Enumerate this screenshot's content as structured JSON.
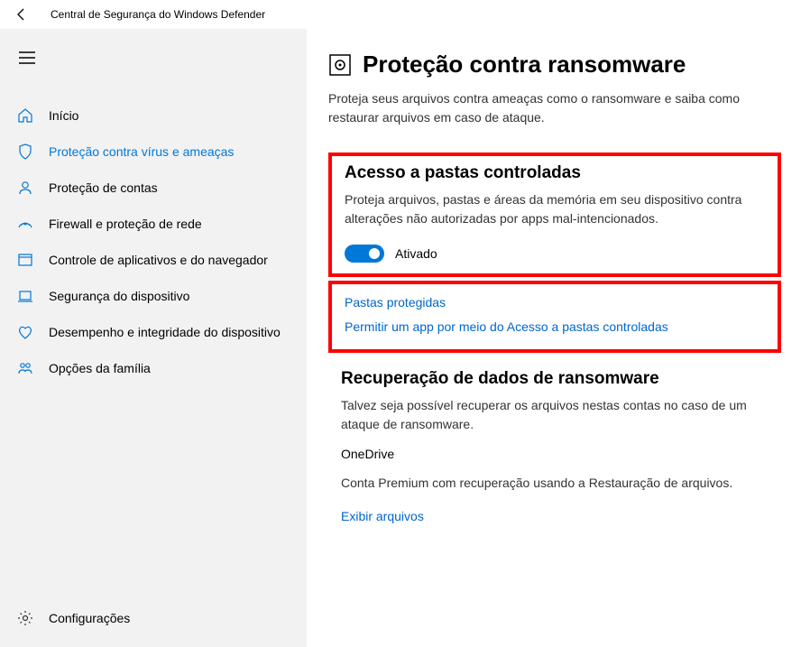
{
  "titlebar": {
    "app_title": "Central de Segurança do Windows Defender"
  },
  "sidebar": {
    "items": [
      {
        "label": "Início",
        "icon": "home"
      },
      {
        "label": "Proteção contra vírus e ameaças",
        "icon": "shield",
        "active": true
      },
      {
        "label": "Proteção de contas",
        "icon": "account"
      },
      {
        "label": "Firewall e proteção de rede",
        "icon": "network"
      },
      {
        "label": "Controle de aplicativos e do navegador",
        "icon": "browser"
      },
      {
        "label": "Segurança do dispositivo",
        "icon": "device"
      },
      {
        "label": "Desempenho e integridade do dispositivo",
        "icon": "health"
      },
      {
        "label": "Opções da família",
        "icon": "family"
      }
    ],
    "settings_label": "Configurações"
  },
  "main": {
    "title": "Proteção contra ransomware",
    "description": "Proteja seus arquivos contra ameaças como o ransomware e saiba como restaurar arquivos em caso de ataque.",
    "folder_access": {
      "title": "Acesso a pastas controladas",
      "description": "Proteja arquivos, pastas e áreas da memória em seu dispositivo contra alterações não autorizadas por apps mal-intencionados.",
      "toggle_label": "Ativado"
    },
    "links": {
      "protected_folders": "Pastas protegidas",
      "allow_app": "Permitir um app por meio do Acesso a pastas controladas"
    },
    "recovery": {
      "title": "Recuperação de dados de ransomware",
      "description": "Talvez seja possível recuperar os arquivos nestas contas no caso de um ataque de ransomware.",
      "service": "OneDrive",
      "account_desc": "Conta Premium com recuperação usando a Restauração de arquivos.",
      "view_files": "Exibir arquivos"
    }
  }
}
